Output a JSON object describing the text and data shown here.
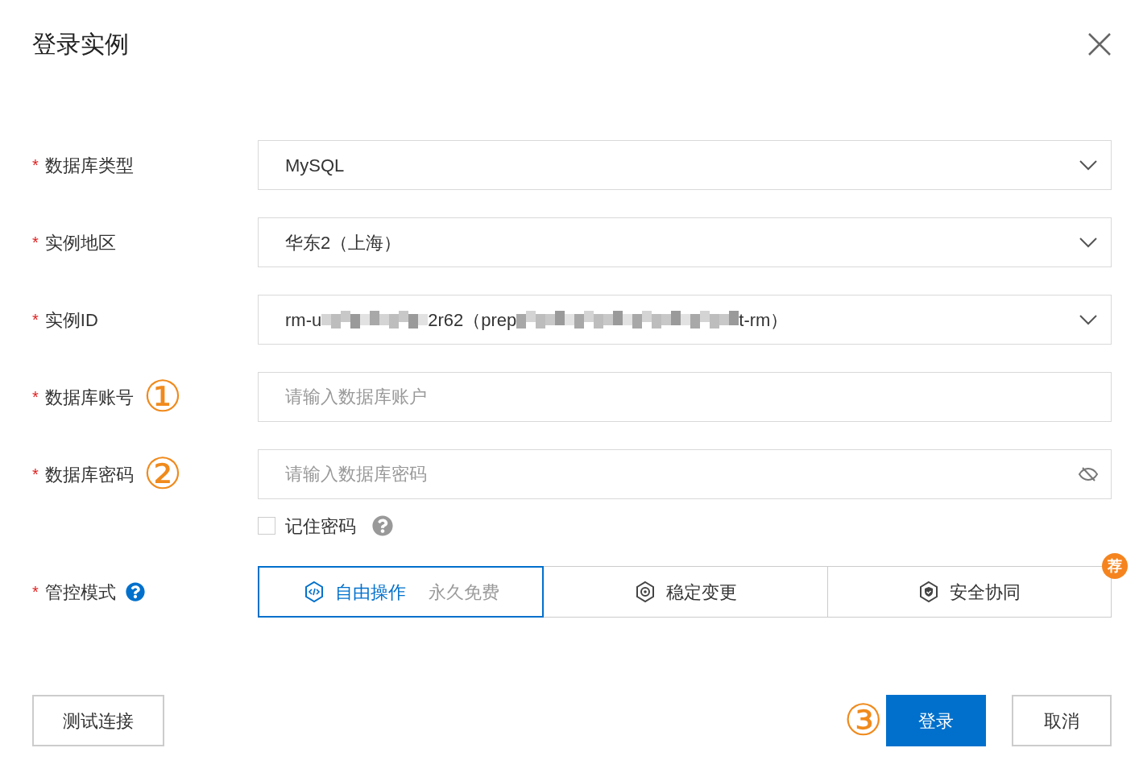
{
  "dialog": {
    "title": "登录实例"
  },
  "fields": [
    {
      "kind": "select",
      "marker": "*",
      "label": "数据库类型",
      "value": "MySQL"
    },
    {
      "kind": "select",
      "marker": "*",
      "label": "实例地区",
      "value": "华东2（上海）"
    },
    {
      "kind": "masked",
      "marker": "*",
      "label": "实例ID",
      "value_parts": [
        "rm-u",
        "2r62（prep",
        "t-rm）"
      ]
    },
    {
      "kind": "input",
      "marker": "*",
      "label": "数据库账号",
      "placeholder": "请输入数据库账户",
      "annotation": "①"
    },
    {
      "kind": "password",
      "marker": "*",
      "label": "数据库密码",
      "placeholder": "请输入数据库密码",
      "annotation": "②"
    }
  ],
  "remember": {
    "label": "记住密码",
    "checked": false
  },
  "mode": {
    "marker": "*",
    "label": "管控模式",
    "options": [
      {
        "kind": "code",
        "label": "自由操作",
        "note": "永久免费",
        "selected": true
      },
      {
        "kind": "gear",
        "label": "稳定变更",
        "selected": false
      },
      {
        "kind": "shield",
        "label": "安全协同",
        "selected": false,
        "badge": "荐"
      }
    ]
  },
  "buttons": [
    {
      "kind": "secondary",
      "label": "测试连接"
    },
    {
      "kind": "primary",
      "label": "登录",
      "annotation": "③"
    },
    {
      "kind": "secondary",
      "label": "取消"
    }
  ]
}
